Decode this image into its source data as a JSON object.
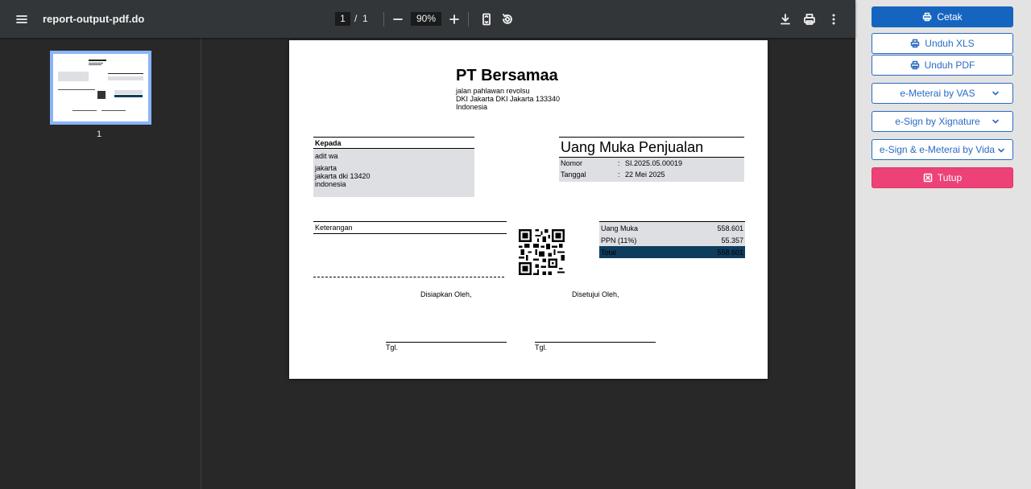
{
  "viewer": {
    "file_name": "report-output-pdf.do",
    "page_current": "1",
    "page_separator": "/",
    "page_total": "1",
    "zoom": "90%",
    "thumbnail_label": "1",
    "icons": [
      "menu-icon",
      "zoom-out-icon",
      "zoom-in-icon",
      "fit-page-icon",
      "rotate-icon",
      "download-icon",
      "print-icon",
      "more-options-icon"
    ]
  },
  "document": {
    "company": {
      "name": "PT Bersamaa",
      "address_lines": [
        "jalan pahlawan revolsu",
        "DKI Jakarta DKI Jakarta 133340",
        "Indonesia"
      ]
    },
    "recipient": {
      "heading": "Kepada",
      "name": "adit wa",
      "address_lines": [
        "jakarta",
        "jakarta dki 13420",
        "indonesia"
      ]
    },
    "doc_type": "Uang Muka Penjualan",
    "meta": [
      {
        "label": "Nomor",
        "sep": ":",
        "value": "SI.2025.05.00019"
      },
      {
        "label": "Tanggal",
        "sep": ":",
        "value": "22 Mei 2025"
      }
    ],
    "remarks_label": "Keterangan",
    "summary": [
      {
        "label": "Uang Muka",
        "value": "558.601"
      },
      {
        "label": "PPN (11%)",
        "value": "55.357"
      },
      {
        "label": "Total",
        "value": "558.601"
      }
    ],
    "signatures": {
      "prepared_by": "Disiapkan Oleh,",
      "approved_by": "Disetujui Oleh,",
      "date_label_1": "Tgl.",
      "date_label_2": "Tgl."
    },
    "colors": {
      "total_row": "#0e3c5c",
      "shaded_box": "#dedfe3"
    }
  },
  "actions": {
    "print": "Cetak",
    "download_xls": "Unduh XLS",
    "download_pdf": "Unduh PDF",
    "emeterai_vas": "e-Meterai by VAS",
    "esign_xignature": "e-Sign by Xignature",
    "esign_emeterai_vida": "e-Sign & e-Meterai by Vida",
    "close": "Tutup",
    "colors": {
      "primary": "#1565c0",
      "outline": "#2a6ac4",
      "danger": "#ec4277"
    }
  }
}
